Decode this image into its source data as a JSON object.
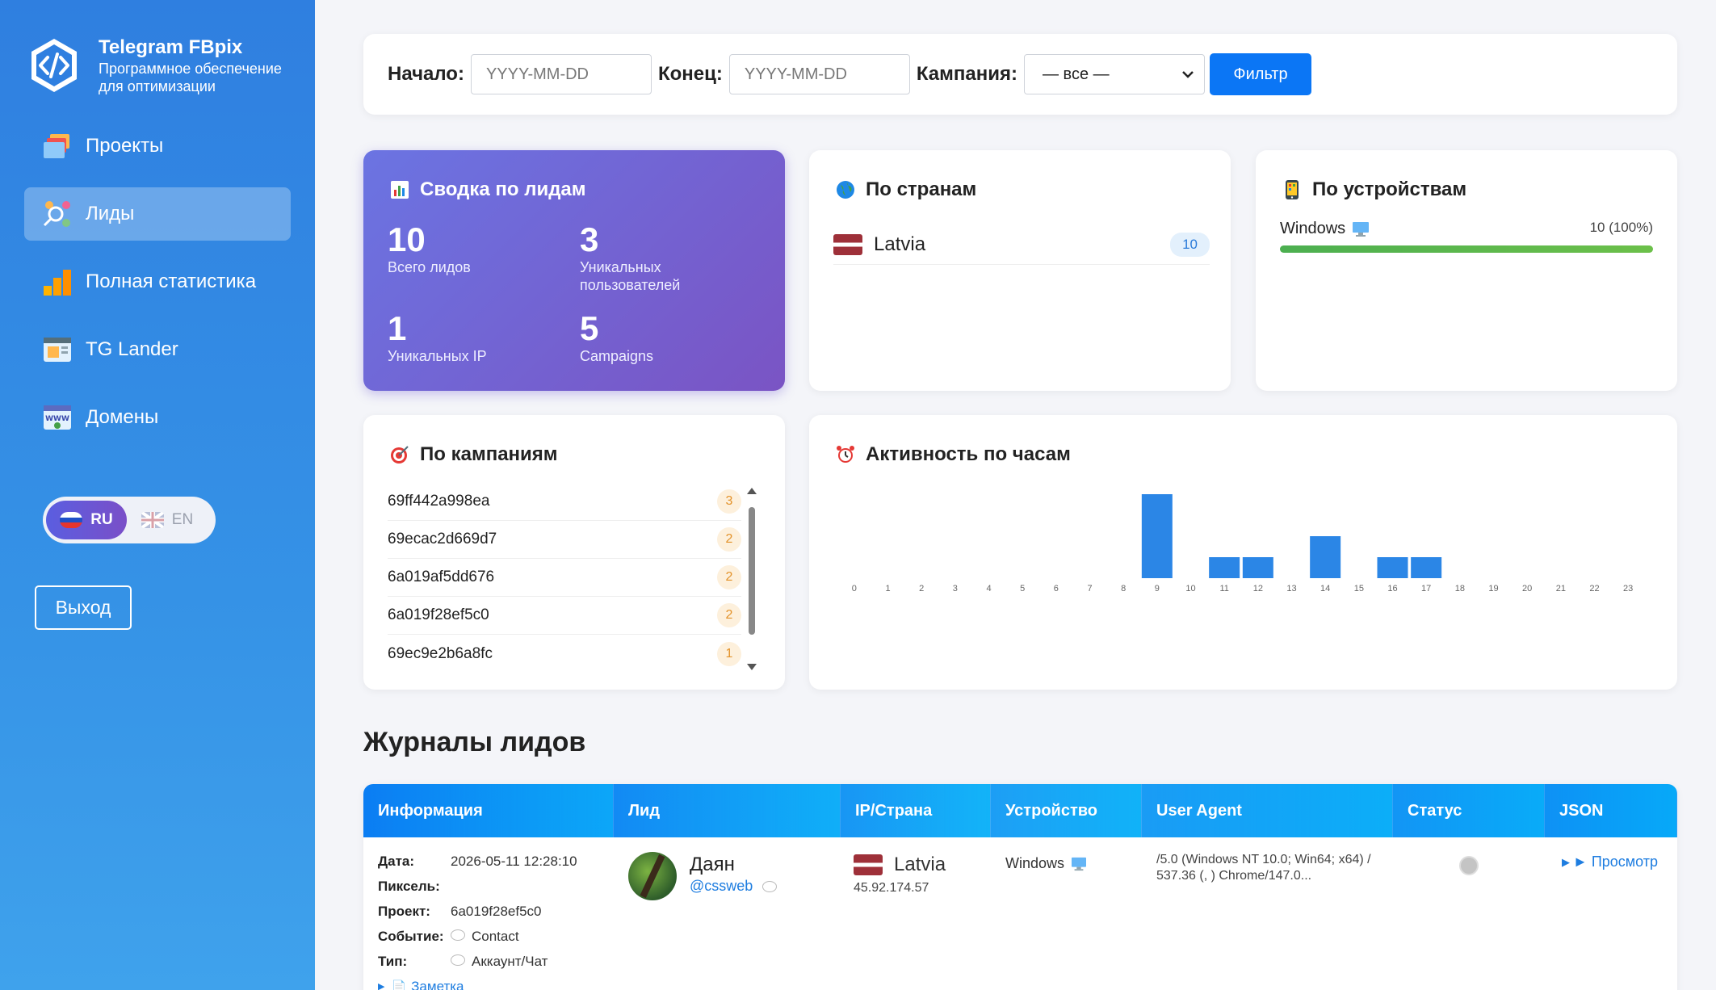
{
  "brand": {
    "title": "Telegram FBpix",
    "subtitle_line1": "Программное обеспечение",
    "subtitle_line2": "для оптимизации"
  },
  "nav": [
    {
      "label": "Проекты",
      "icon": "folders-icon"
    },
    {
      "label": "Лиды",
      "icon": "users-search-icon",
      "active": true
    },
    {
      "label": "Полная статистика",
      "icon": "bar-chart-icon"
    },
    {
      "label": "TG Lander",
      "icon": "browser-window-icon"
    },
    {
      "label": "Домены",
      "icon": "www-domain-icon"
    }
  ],
  "lang": {
    "ru": "RU",
    "en": "EN"
  },
  "logout": "Выход",
  "filter": {
    "start_label": "Начало:",
    "start_placeholder": "YYYY-MM-DD",
    "end_label": "Конец:",
    "end_placeholder": "YYYY-MM-DD",
    "campaign_label": "Кампания:",
    "campaign_value": "— все —",
    "button": "Фильтр"
  },
  "summary": {
    "title": "Сводка по лидам",
    "total_leads": "10",
    "total_leads_label": "Всего лидов",
    "unique_users": "3",
    "unique_users_label_1": "Уникальных",
    "unique_users_label_2": "пользователей",
    "unique_ip": "1",
    "unique_ip_label": "Уникальных IP",
    "campaigns": "5",
    "campaigns_label": "Campaigns"
  },
  "countries": {
    "title": "По странам",
    "items": [
      {
        "name": "Latvia",
        "count": "10"
      }
    ]
  },
  "devices": {
    "title": "По устройствам",
    "items": [
      {
        "name": "Windows",
        "value": "10 (100%)",
        "share": 1.0
      }
    ]
  },
  "campaigns": {
    "title": "По кампаниям",
    "items": [
      {
        "id": "69ff442a998ea",
        "count": "3"
      },
      {
        "id": "69ecac2d669d7",
        "count": "2"
      },
      {
        "id": "6a019af5dd676",
        "count": "2"
      },
      {
        "id": "6a019f28ef5c0",
        "count": "2"
      },
      {
        "id": "69ec9e2b6a8fc",
        "count": "1"
      }
    ]
  },
  "chart_data": {
    "type": "bar",
    "title": "Активность по часам",
    "categories": [
      "0",
      "1",
      "2",
      "3",
      "4",
      "5",
      "6",
      "7",
      "8",
      "9",
      "10",
      "11",
      "12",
      "13",
      "14",
      "15",
      "16",
      "17",
      "18",
      "19",
      "20",
      "21",
      "22",
      "23"
    ],
    "values": [
      0,
      0,
      0,
      0,
      0,
      0,
      0,
      0,
      0,
      4,
      0,
      1,
      1,
      0,
      2,
      0,
      1,
      1,
      0,
      0,
      0,
      0,
      0,
      0
    ],
    "ylim": [
      0,
      4
    ],
    "grid": false,
    "bar_color": "#2b86e6"
  },
  "logs": {
    "title": "Журналы лидов",
    "columns": [
      "Информация",
      "Лид",
      "IP/Страна",
      "Устройство",
      "User Agent",
      "Статус",
      "JSON"
    ],
    "row": {
      "date_label": "Дата:",
      "date": "2026-05-11 12:28:10",
      "pixel_label": "Пиксель:",
      "project_label": "Проект:",
      "project": "6a019f28ef5c0",
      "event_label": "Событие:",
      "event": "Contact",
      "type_label": "Тип:",
      "type": "Аккаунт/Чат",
      "note": "Заметка",
      "lead_name": "Даян",
      "lead_handle": "@cssweb",
      "country": "Latvia",
      "ip": "45.92.174.57",
      "device": "Windows",
      "ua_line1": "/5.0 (Windows NT 10.0; Win64; x64) /",
      "ua_line2": "537.36 (, ) Chrome/147.0...",
      "view": "► Просмотр"
    }
  }
}
